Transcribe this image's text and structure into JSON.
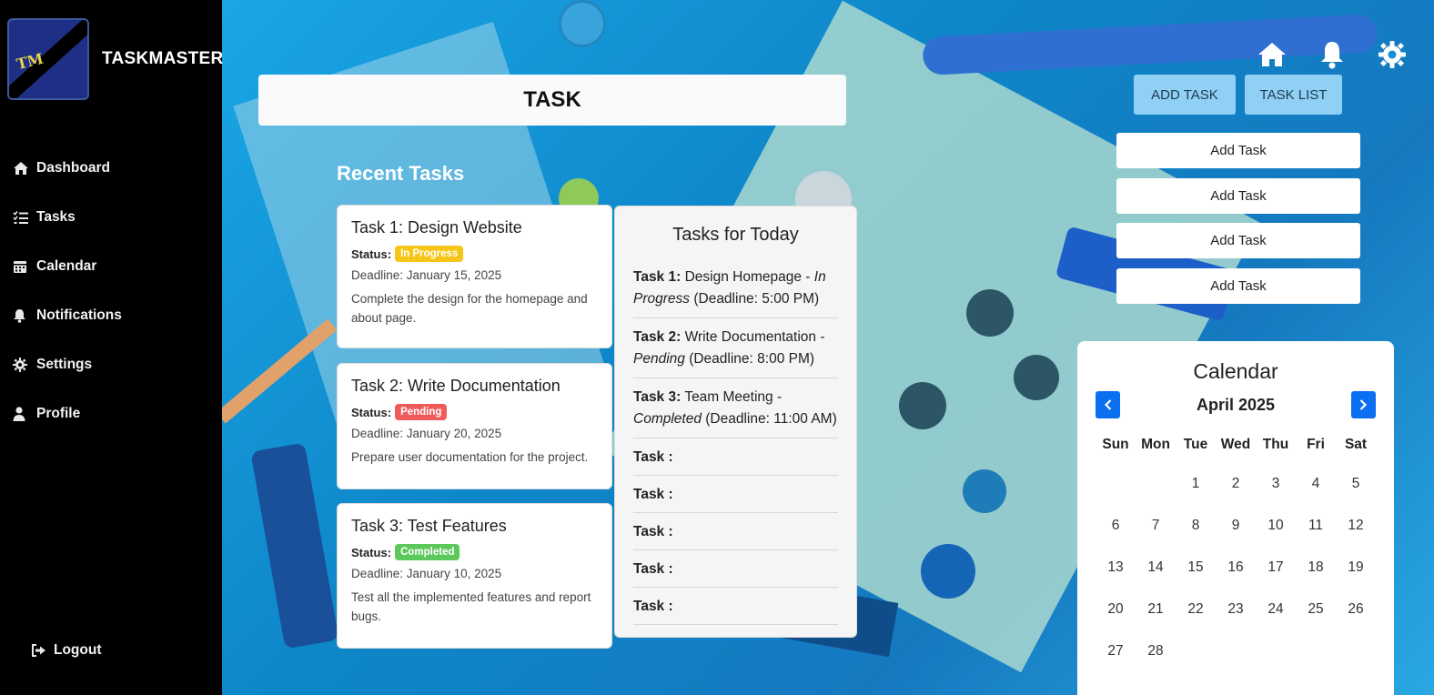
{
  "brand": {
    "name": "TASKMASTER",
    "logo_text": "TASKMASTER"
  },
  "sidebar": {
    "items": [
      {
        "label": "Dashboard",
        "icon": "home-icon"
      },
      {
        "label": "Tasks",
        "icon": "task-list-icon"
      },
      {
        "label": "Calendar",
        "icon": "calendar-icon"
      },
      {
        "label": "Notifications",
        "icon": "bell-icon"
      },
      {
        "label": "Settings",
        "icon": "gear-icon"
      },
      {
        "label": "Profile",
        "icon": "user-icon"
      }
    ],
    "logout": {
      "label": "Logout",
      "icon": "sign-out-icon"
    }
  },
  "header": {
    "title": "TASK"
  },
  "toolbar": {
    "icons": [
      "home-icon",
      "bell-icon",
      "gear-icon"
    ],
    "add_task_label": "ADD TASK",
    "task_list_label": "TASK LIST"
  },
  "add_stack": [
    "Add Task",
    "Add Task",
    "Add Task",
    "Add Task"
  ],
  "recent": {
    "title": "Recent Tasks",
    "tasks": [
      {
        "title": "Task 1: Design Website",
        "status_label": "Status:",
        "status": "In Progress",
        "status_color": "#f5c518",
        "deadline": "Deadline: January 15, 2025",
        "desc": "Complete the design for the homepage and about page."
      },
      {
        "title": "Task 2: Write Documentation",
        "status_label": "Status:",
        "status": "Pending",
        "status_color": "#ef5b5b",
        "deadline": "Deadline: January 20, 2025",
        "desc": "Prepare user documentation for the project."
      },
      {
        "title": "Task 3: Test Features",
        "status_label": "Status:",
        "status": "Completed",
        "status_color": "#5cc85c",
        "deadline": "Deadline: January 10, 2025",
        "desc": "Test all the implemented features and report bugs."
      }
    ]
  },
  "today": {
    "title": "Tasks for Today",
    "rows": [
      {
        "label": "Task 1:",
        "name": "Design Homepage - ",
        "status": "In Progress",
        "deadline": " (Deadline: 5:00 PM)"
      },
      {
        "label": "Task 2:",
        "name": "Write Documentation - ",
        "status": "Pending",
        "deadline": " (Deadline: 8:00 PM)"
      },
      {
        "label": "Task 3:",
        "name": "Team Meeting - ",
        "status": "Completed",
        "deadline": " (Deadline: 11:00 AM)"
      }
    ],
    "empty_rows": [
      "Task :",
      "Task :",
      "Task :",
      "Task :",
      "Task :"
    ]
  },
  "calendar": {
    "title": "Calendar",
    "month": "April 2025",
    "weekdays": [
      "Sun",
      "Mon",
      "Tue",
      "Wed",
      "Thu",
      "Fri",
      "Sat"
    ],
    "leading_blanks": 2,
    "days": [
      "1",
      "2",
      "3",
      "4",
      "5",
      "6",
      "7",
      "8",
      "9",
      "10",
      "11",
      "12",
      "13",
      "14",
      "15",
      "16",
      "17",
      "18",
      "19",
      "20",
      "21",
      "22",
      "23",
      "24",
      "25",
      "26",
      "27",
      "28"
    ],
    "accent": "#0a6ff0"
  }
}
